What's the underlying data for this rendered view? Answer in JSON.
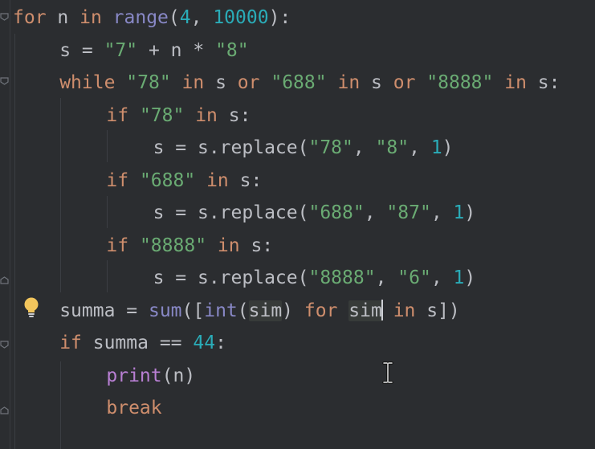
{
  "editor": {
    "lines": [
      {
        "indent": 0,
        "tokens": [
          {
            "t": "for",
            "c": "kw"
          },
          {
            "t": " n ",
            "c": "var"
          },
          {
            "t": "in",
            "c": "kw"
          },
          {
            "t": " ",
            "c": "var"
          },
          {
            "t": "range",
            "c": "bi"
          },
          {
            "t": "(",
            "c": "op"
          },
          {
            "t": "4",
            "c": "num"
          },
          {
            "t": ", ",
            "c": "op"
          },
          {
            "t": "10000",
            "c": "num"
          },
          {
            "t": "):",
            "c": "op"
          }
        ]
      },
      {
        "indent": 1,
        "tokens": [
          {
            "t": "s = ",
            "c": "var"
          },
          {
            "t": "\"7\"",
            "c": "str"
          },
          {
            "t": " + n * ",
            "c": "op"
          },
          {
            "t": "\"8\"",
            "c": "str"
          }
        ]
      },
      {
        "indent": 1,
        "tokens": [
          {
            "t": "while",
            "c": "kw"
          },
          {
            "t": " ",
            "c": "var"
          },
          {
            "t": "\"78\"",
            "c": "str"
          },
          {
            "t": " ",
            "c": "var"
          },
          {
            "t": "in",
            "c": "kw"
          },
          {
            "t": " s ",
            "c": "var"
          },
          {
            "t": "or",
            "c": "kw"
          },
          {
            "t": " ",
            "c": "var"
          },
          {
            "t": "\"688\"",
            "c": "str"
          },
          {
            "t": " ",
            "c": "var"
          },
          {
            "t": "in",
            "c": "kw"
          },
          {
            "t": " s ",
            "c": "var"
          },
          {
            "t": "or",
            "c": "kw"
          },
          {
            "t": " ",
            "c": "var"
          },
          {
            "t": "\"8888\"",
            "c": "str"
          },
          {
            "t": " ",
            "c": "var"
          },
          {
            "t": "in",
            "c": "kw"
          },
          {
            "t": " s:",
            "c": "var"
          }
        ]
      },
      {
        "indent": 2,
        "tokens": [
          {
            "t": "if",
            "c": "kw"
          },
          {
            "t": " ",
            "c": "var"
          },
          {
            "t": "\"78\"",
            "c": "str"
          },
          {
            "t": " ",
            "c": "var"
          },
          {
            "t": "in",
            "c": "kw"
          },
          {
            "t": " s:",
            "c": "var"
          }
        ]
      },
      {
        "indent": 3,
        "tokens": [
          {
            "t": "s = s.replace(",
            "c": "var"
          },
          {
            "t": "\"78\"",
            "c": "str"
          },
          {
            "t": ", ",
            "c": "op"
          },
          {
            "t": "\"8\"",
            "c": "str"
          },
          {
            "t": ", ",
            "c": "op"
          },
          {
            "t": "1",
            "c": "num"
          },
          {
            "t": ")",
            "c": "op"
          }
        ]
      },
      {
        "indent": 2,
        "tokens": [
          {
            "t": "if",
            "c": "kw"
          },
          {
            "t": " ",
            "c": "var"
          },
          {
            "t": "\"688\"",
            "c": "str"
          },
          {
            "t": " ",
            "c": "var"
          },
          {
            "t": "in",
            "c": "kw"
          },
          {
            "t": " s:",
            "c": "var"
          }
        ]
      },
      {
        "indent": 3,
        "tokens": [
          {
            "t": "s = s.replace(",
            "c": "var"
          },
          {
            "t": "\"688\"",
            "c": "str"
          },
          {
            "t": ", ",
            "c": "op"
          },
          {
            "t": "\"87\"",
            "c": "str"
          },
          {
            "t": ", ",
            "c": "op"
          },
          {
            "t": "1",
            "c": "num"
          },
          {
            "t": ")",
            "c": "op"
          }
        ]
      },
      {
        "indent": 2,
        "tokens": [
          {
            "t": "if",
            "c": "kw"
          },
          {
            "t": " ",
            "c": "var"
          },
          {
            "t": "\"8888\"",
            "c": "str"
          },
          {
            "t": " ",
            "c": "var"
          },
          {
            "t": "in",
            "c": "kw"
          },
          {
            "t": " s:",
            "c": "var"
          }
        ]
      },
      {
        "indent": 3,
        "tokens": [
          {
            "t": "s = s.replace(",
            "c": "var"
          },
          {
            "t": "\"8888\"",
            "c": "str"
          },
          {
            "t": ", ",
            "c": "op"
          },
          {
            "t": "\"6\"",
            "c": "str"
          },
          {
            "t": ", ",
            "c": "op"
          },
          {
            "t": "1",
            "c": "num"
          },
          {
            "t": ")",
            "c": "op"
          }
        ]
      },
      {
        "indent": 1,
        "tokens": [
          {
            "t": "summa = ",
            "c": "var"
          },
          {
            "t": "sum",
            "c": "bi"
          },
          {
            "t": "([",
            "c": "op"
          },
          {
            "t": "int",
            "c": "bi"
          },
          {
            "t": "(",
            "c": "op"
          },
          {
            "t": "sim",
            "c": "var hl-sim"
          },
          {
            "t": ") ",
            "c": "op"
          },
          {
            "t": "for",
            "c": "kw"
          },
          {
            "t": " ",
            "c": "var"
          },
          {
            "t": "sim",
            "c": "var hl-sim",
            "caret": true
          },
          {
            "t": " ",
            "c": "var"
          },
          {
            "t": "in",
            "c": "kw"
          },
          {
            "t": " s])",
            "c": "var"
          }
        ]
      },
      {
        "indent": 1,
        "tokens": [
          {
            "t": "if",
            "c": "kw"
          },
          {
            "t": " summa == ",
            "c": "var"
          },
          {
            "t": "44",
            "c": "num"
          },
          {
            "t": ":",
            "c": "op"
          }
        ]
      },
      {
        "indent": 2,
        "tokens": [
          {
            "t": "print",
            "c": "fn"
          },
          {
            "t": "(n)",
            "c": "var"
          }
        ]
      },
      {
        "indent": 2,
        "tokens": [
          {
            "t": "break",
            "c": "kw"
          }
        ]
      }
    ],
    "intention_icon": "lightbulb-icon",
    "cursor_icon": "ibeam-cursor-icon",
    "colors": {
      "background": "#2b2d30",
      "keyword": "#cf8e6d",
      "string": "#6aab73",
      "number": "#2aacb8",
      "builtin": "#8888c6",
      "function": "#b87fd3",
      "text": "#bcbec4"
    }
  }
}
